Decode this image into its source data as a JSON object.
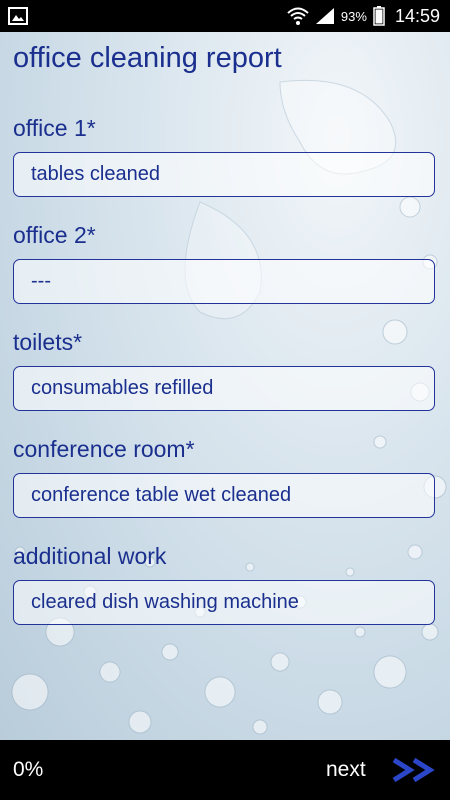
{
  "status_bar": {
    "battery_percent": "93%",
    "time": "14:59",
    "icons": [
      "image-icon",
      "wifi-icon",
      "signal-icon",
      "battery-icon"
    ]
  },
  "form": {
    "title": "office cleaning report",
    "fields": [
      {
        "label": "office 1*",
        "value": "tables cleaned"
      },
      {
        "label": "office 2*",
        "value": "---"
      },
      {
        "label": "toilets*",
        "value": "consumables refilled"
      },
      {
        "label": "conference room*",
        "value": "conference table wet cleaned"
      },
      {
        "label": "additional work",
        "value": "cleared dish washing machine"
      }
    ]
  },
  "footer": {
    "progress": "0%",
    "next_label": "next",
    "next_icon": "double-chevron-right-icon"
  },
  "colors": {
    "text_primary": "#1a2f8e",
    "bar_background": "#000000",
    "accent_arrow": "#2b46c8"
  }
}
